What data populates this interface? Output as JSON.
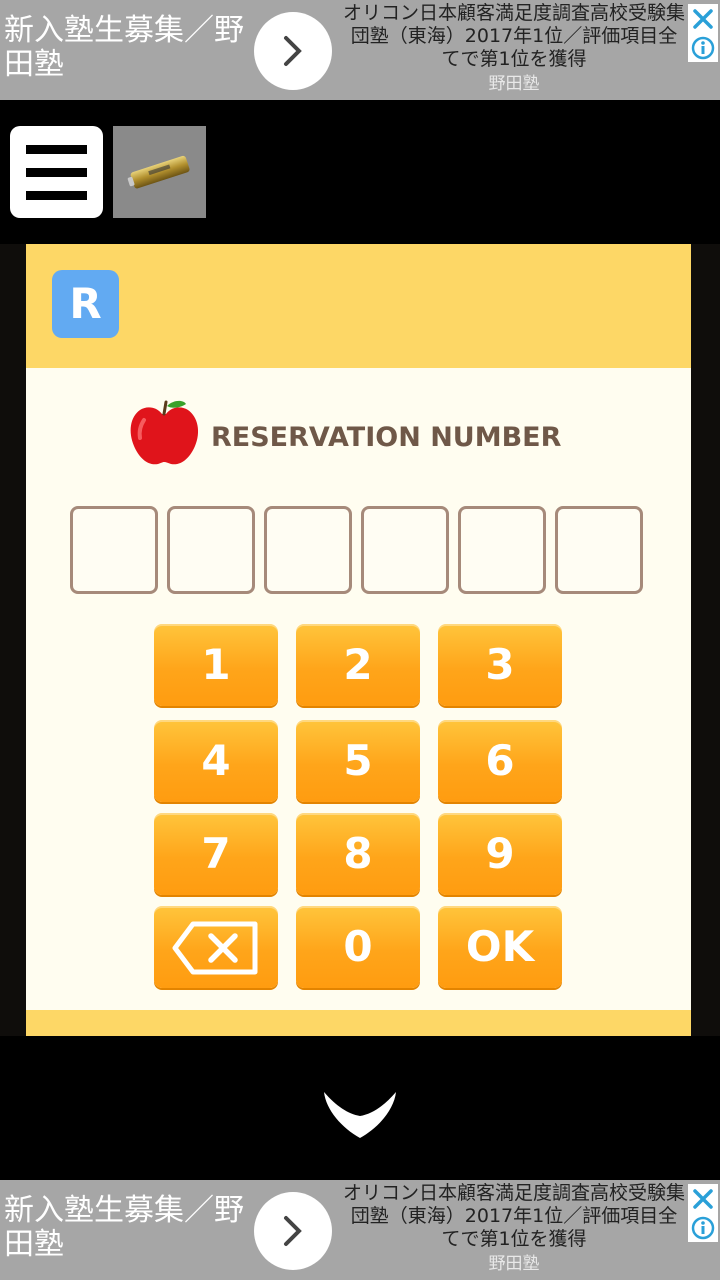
{
  "ads": {
    "top": {
      "headline": "新入塾生募集／野田塾",
      "description": "オリコン日本顧客満足度調査高校受験集団塾（東海）2017年1位／評価項目全てで第1位を獲得",
      "source": "野田塾"
    },
    "bottom": {
      "headline": "新入塾生募集／野田塾",
      "description": "オリコン日本顧客満足度調査高校受験集団塾（東海）2017年1位／評価項目全てで第1位を獲得",
      "source": "野田塾"
    },
    "icons": [
      "chevron-right-icon",
      "close-icon",
      "info-icon"
    ]
  },
  "toolbar": {
    "menu_icon": "hamburger-icon",
    "item": "battery"
  },
  "panel": {
    "badge": "R",
    "title": "RESERVATION NUMBER",
    "code_digits": [
      "",
      "",
      "",
      "",
      "",
      ""
    ],
    "keys": [
      "1",
      "2",
      "3",
      "4",
      "5",
      "6",
      "7",
      "8",
      "9",
      "",
      "0",
      "OK"
    ],
    "backspace_icon": "backspace-icon"
  },
  "navigation": {
    "down_icon": "chevron-down-icon"
  },
  "colors": {
    "header": "#fdd766",
    "key": "#ffa51a",
    "badge": "#62aaf2",
    "apple": "#e0141b",
    "text": "#6f5848"
  }
}
